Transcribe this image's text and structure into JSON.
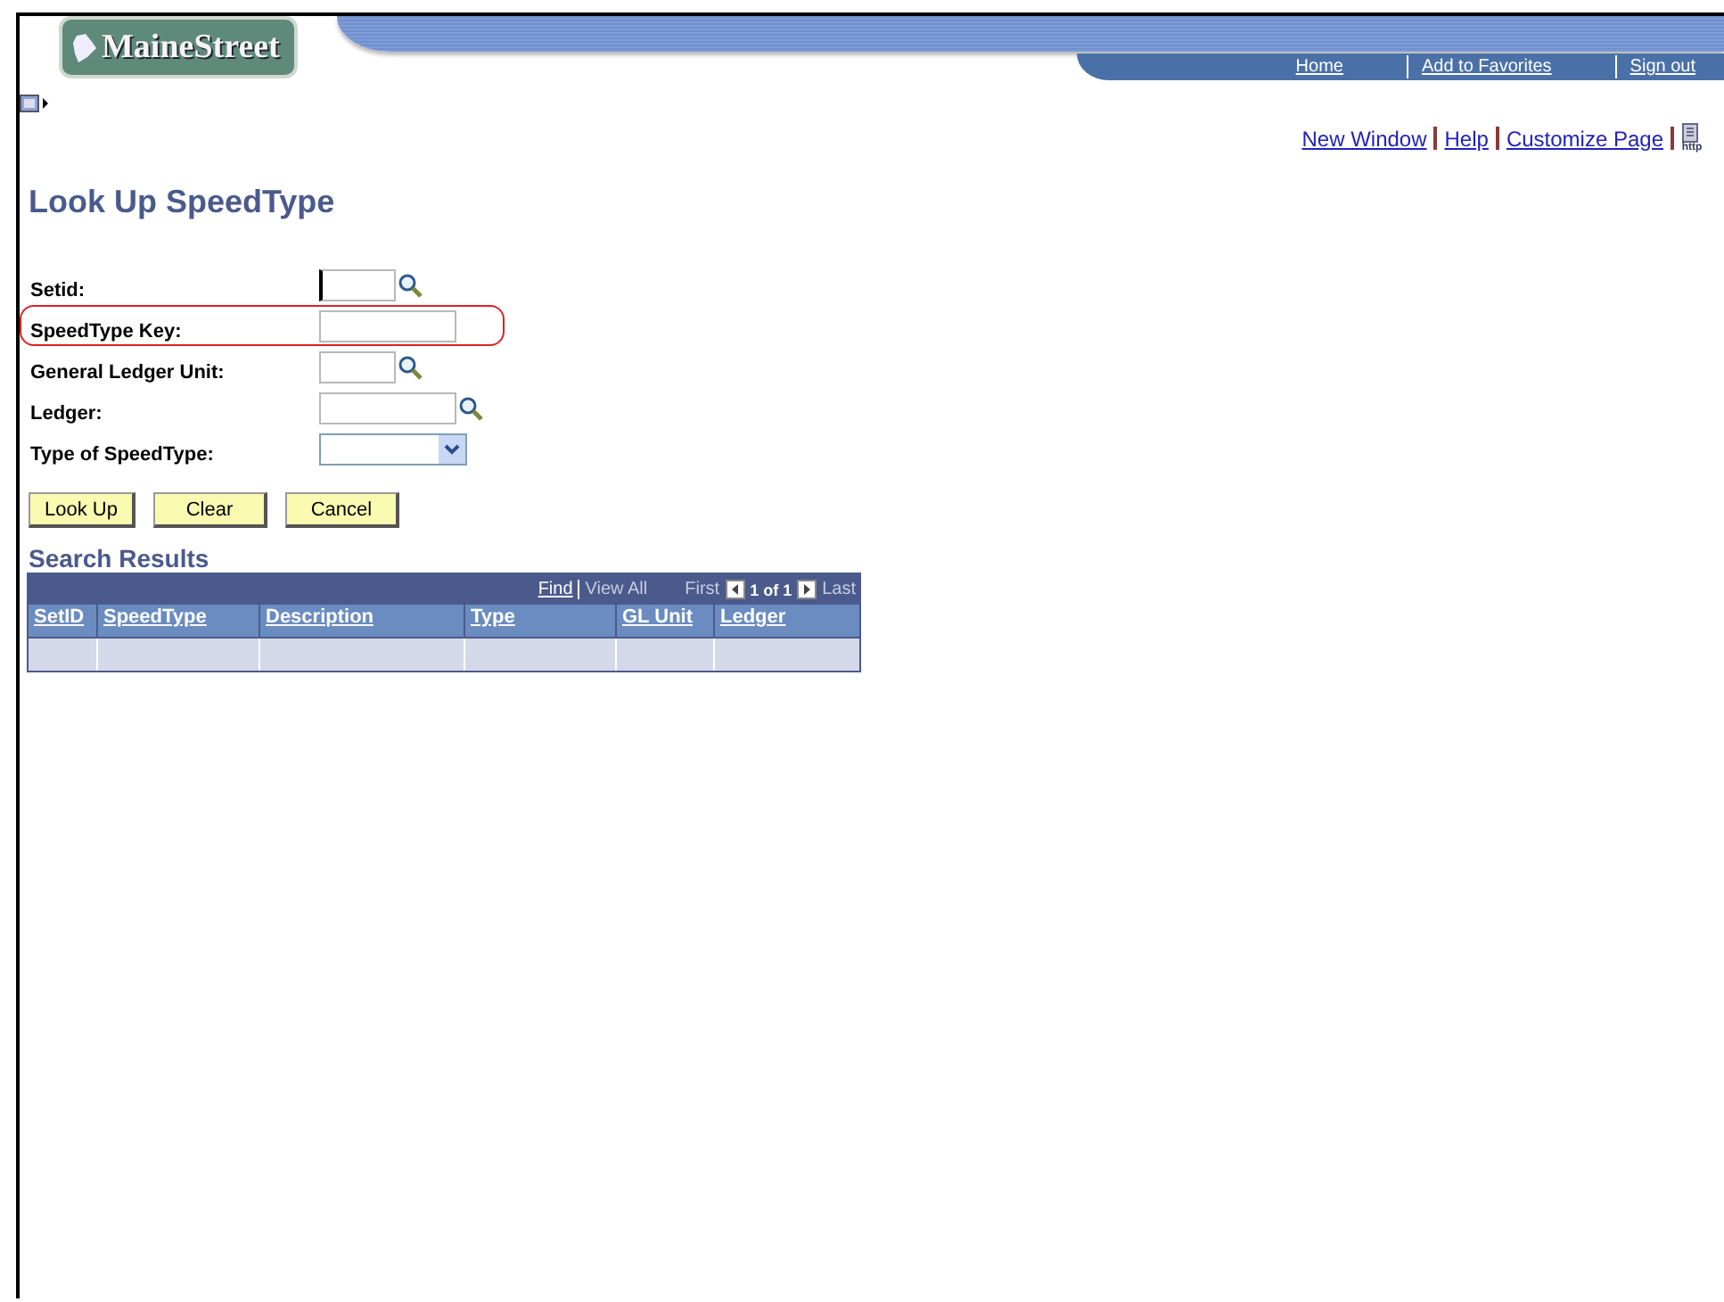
{
  "header": {
    "logo": "MaineStreet",
    "nav": [
      "Home",
      "Add to Favorites",
      "Sign out"
    ]
  },
  "page_links": [
    "New Window",
    "Help",
    "Customize Page"
  ],
  "page_icon_caption": "http",
  "title": "Look Up SpeedType",
  "fields": [
    {
      "label": "Setid:",
      "kind": "code",
      "focused": true,
      "highlighted": false
    },
    {
      "label": "SpeedType Key:",
      "kind": "text",
      "focused": false,
      "highlighted": true
    },
    {
      "label": "General Ledger Unit:",
      "kind": "code",
      "focused": false,
      "highlighted": false
    },
    {
      "label": "Ledger:",
      "kind": "lookup",
      "focused": false,
      "highlighted": false
    },
    {
      "label": "Type of SpeedType:",
      "kind": "select",
      "focused": false,
      "highlighted": false
    }
  ],
  "buttons": [
    "Look Up",
    "Clear",
    "Cancel"
  ],
  "results": {
    "title": "Search Results",
    "find": "Find",
    "view_all": "View All",
    "first": "First",
    "count": "1 of 1",
    "last": "Last",
    "columns": [
      "SetID",
      "SpeedType",
      "Description",
      "Type",
      "GL Unit",
      "Ledger"
    ]
  }
}
